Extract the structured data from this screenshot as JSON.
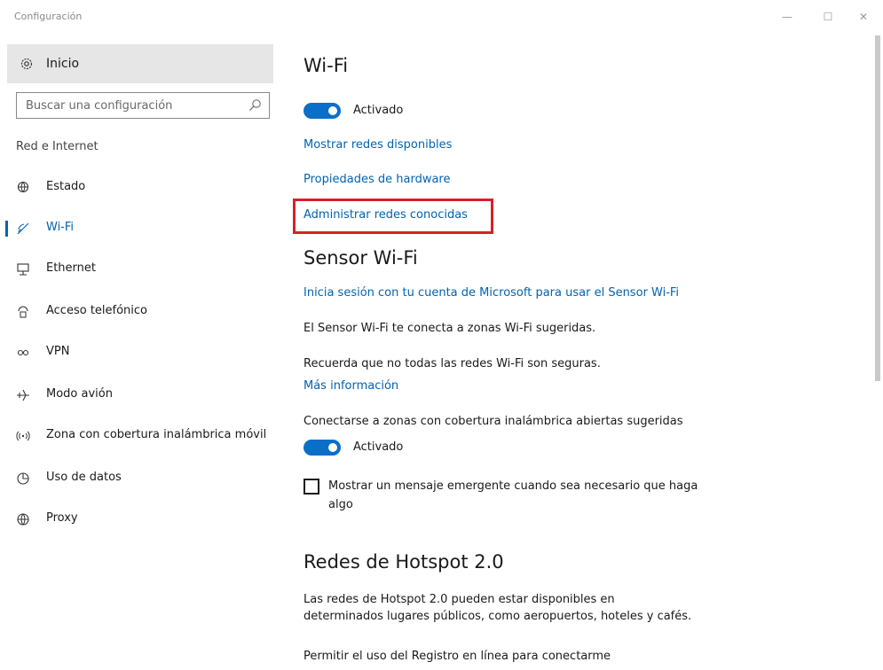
{
  "window": {
    "title": "Configuración",
    "controls": {
      "minimize": "—",
      "maximize": "☐",
      "close": "✕"
    }
  },
  "sidebar": {
    "home_label": "Inicio",
    "search_placeholder": "Buscar una configuración",
    "section_title": "Red e Internet",
    "items": [
      {
        "label": "Estado",
        "icon": "status-globe-icon"
      },
      {
        "label": "Wi-Fi",
        "icon": "wifi-icon",
        "active": true
      },
      {
        "label": "Ethernet",
        "icon": "ethernet-icon"
      },
      {
        "label": "Acceso telefónico",
        "icon": "dialup-icon"
      },
      {
        "label": "VPN",
        "icon": "vpn-icon"
      },
      {
        "label": "Modo avión",
        "icon": "airplane-icon"
      },
      {
        "label": "Zona con cobertura inalámbrica móvil",
        "icon": "hotspot-icon"
      },
      {
        "label": "Uso de datos",
        "icon": "data-usage-icon"
      },
      {
        "label": "Proxy",
        "icon": "proxy-globe-icon"
      }
    ]
  },
  "main": {
    "wifi": {
      "title": "Wi-Fi",
      "toggle_label": "Activado",
      "toggle_on": true,
      "link_show_networks": "Mostrar redes disponibles",
      "link_hardware": "Propiedades de hardware",
      "link_manage_known": "Administrar redes conocidas"
    },
    "sense": {
      "title": "Sensor Wi-Fi",
      "signin_link": "Inicia sesión con tu cuenta de Microsoft para usar el Sensor Wi-Fi",
      "desc": "El Sensor Wi-Fi te conecta a zonas Wi-Fi sugeridas.",
      "warning": "Recuerda que no todas las redes Wi-Fi son seguras.",
      "more_info_link": "Más información",
      "connect_label": "Conectarse a zonas con cobertura inalámbrica abiertas sugeridas",
      "connect_toggle_label": "Activado",
      "connect_toggle_on": true,
      "checkbox_line1": "Mostrar un mensaje emergente cuando sea necesario que haga",
      "checkbox_line2": "algo",
      "checkbox_checked": false
    },
    "hotspot": {
      "title": "Redes de Hotspot 2.0",
      "desc_line1": "Las redes de Hotspot 2.0 pueden estar disponibles en",
      "desc_line2": "determinados lugares públicos, como aeropuertos, hoteles y cafés.",
      "permit_label": "Permitir el uso del Registro en línea para conectarme"
    }
  },
  "colors": {
    "accent": "#0063b1",
    "toggle": "#0a6fc9",
    "highlight_box": "#d6202a"
  }
}
